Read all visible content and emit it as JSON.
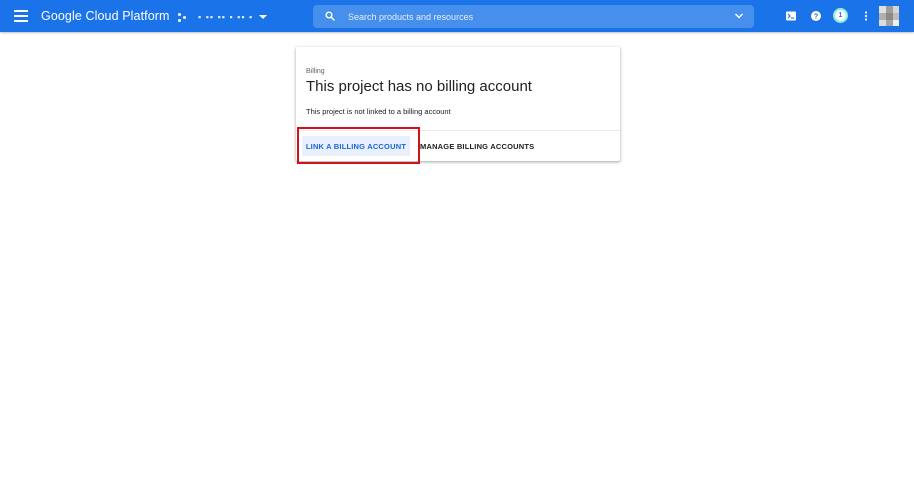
{
  "topbar": {
    "brand": "Google Cloud Platform",
    "project_name": "▪ ▪▪ ▪▪ ▪  ▪▪ ▪",
    "search_placeholder": "Search products and resources",
    "notification_count": "1",
    "icons": {
      "menu": "hamburger-icon",
      "project": "project-picker-icon",
      "search": "search-icon",
      "expand": "chevron-down-icon",
      "shell": "cloud-shell-icon",
      "help": "help-icon",
      "more": "more-vert-icon",
      "avatar": "avatar"
    },
    "color": "#1a73e8"
  },
  "card": {
    "eyebrow": "Billing",
    "title": "This project has no billing account",
    "description": "This project is not linked to a billing account",
    "link_button": "LINK A BILLING ACCOUNT",
    "manage_button": "MANAGE BILLING ACCOUNTS"
  },
  "colors": {
    "accent": "#1a73e8",
    "highlight": "#d1121a",
    "link_button_bg": "#e8f0fe"
  }
}
